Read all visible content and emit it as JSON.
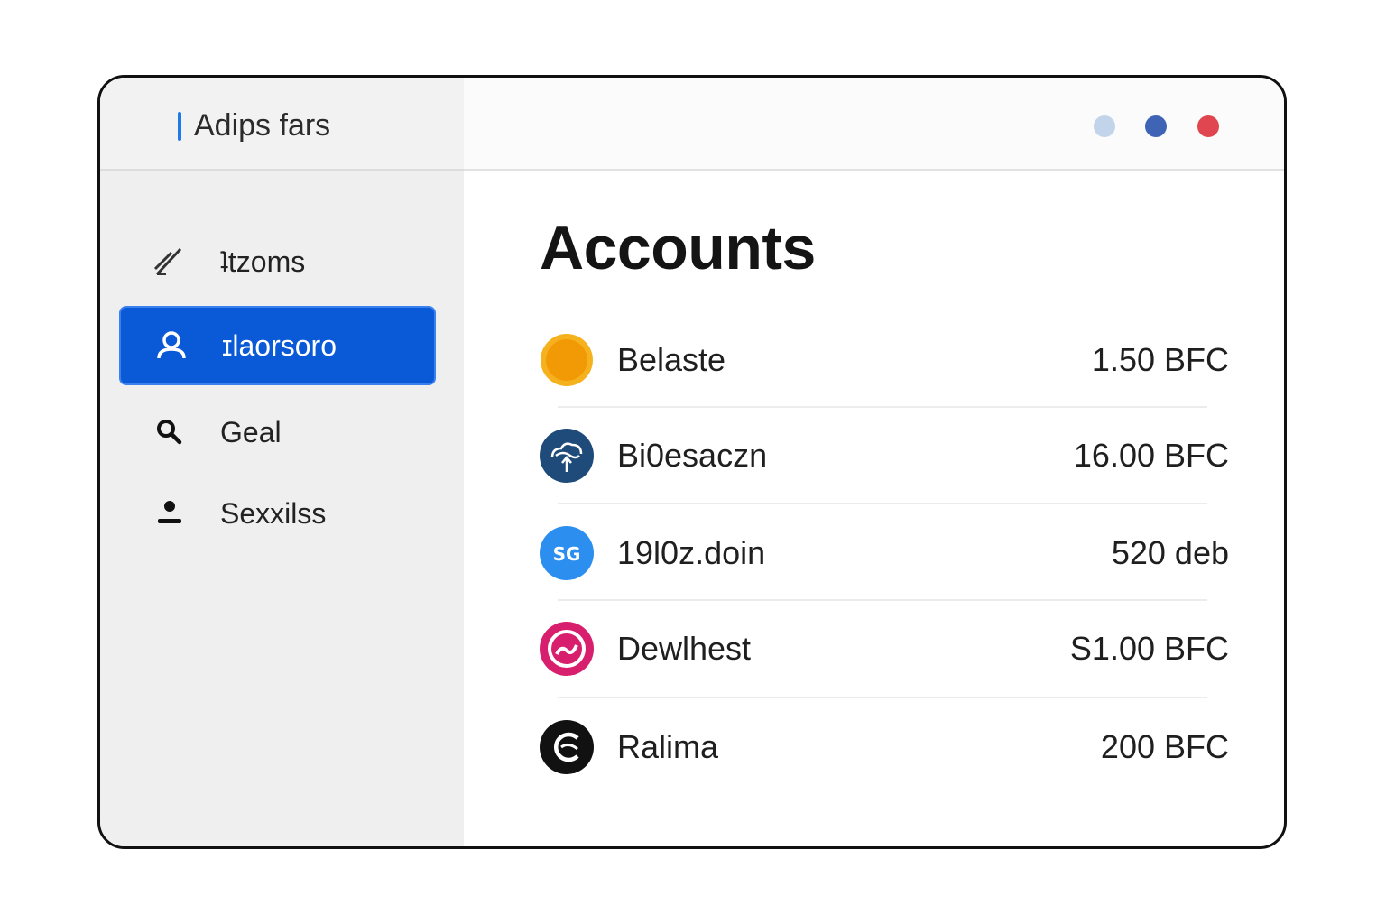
{
  "app": {
    "title": "Adips fars"
  },
  "window_controls": [
    {
      "name": "minimize",
      "color": "#c2d4ea"
    },
    {
      "name": "maximize",
      "color": "#3f64b5"
    },
    {
      "name": "close",
      "color": "#e0464f"
    }
  ],
  "sidebar": {
    "items": [
      {
        "label": "ʇtzoms",
        "icon": "pen-icon",
        "active": false
      },
      {
        "label": "ɪlaorsoro",
        "icon": "user-circle-icon",
        "active": true
      },
      {
        "label": "Geal",
        "icon": "search-icon",
        "active": false
      },
      {
        "label": "Sexxilss",
        "icon": "person-icon",
        "active": false
      }
    ]
  },
  "main": {
    "title": "Accounts",
    "accounts": [
      {
        "name": "Belaste",
        "amount": "1.50 BFC",
        "icon": "orange-coin-icon",
        "color": "#f4a20c"
      },
      {
        "name": "Bi0esaczn",
        "amount": "16.00 BFC",
        "icon": "cloud-upload-icon",
        "color": "#1f4b7a"
      },
      {
        "name": "19l0z.doin",
        "amount": "520 deb",
        "icon": "sg-badge-icon",
        "color": "#2c8ff0"
      },
      {
        "name": "Dewlhest",
        "amount": "S1.00 BFC",
        "icon": "swirl-icon",
        "color": "#d81f6e"
      },
      {
        "name": "Ralima",
        "amount": "200 BFC",
        "icon": "c-logo-icon",
        "color": "#111111"
      }
    ]
  },
  "colors": {
    "accent": "#0a5ad8",
    "sidebar_bg": "#efefef"
  }
}
